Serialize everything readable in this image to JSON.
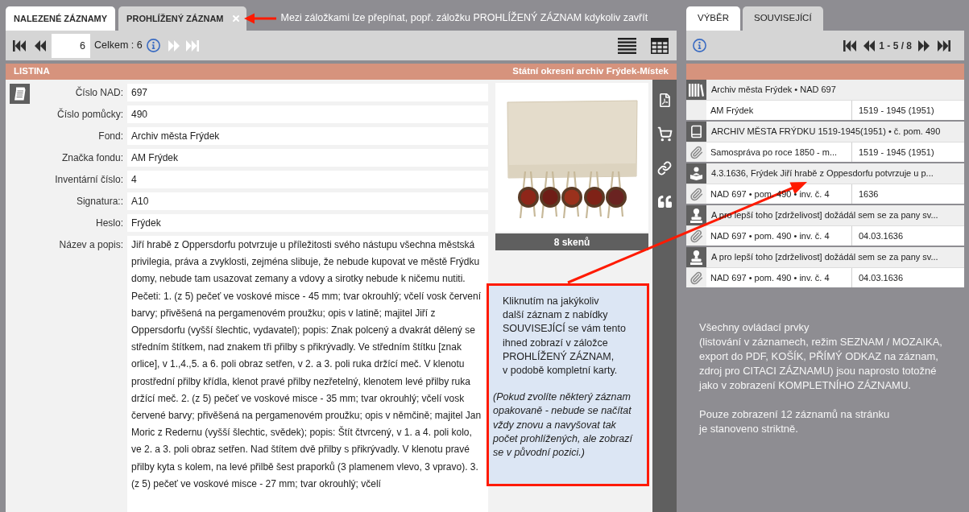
{
  "left_panel": {
    "tabs": [
      {
        "label": "NALEZENÉ ZÁZNAMY",
        "selected": true,
        "closable": false
      },
      {
        "label": "PROHLÍŽENÝ ZÁZNAM",
        "selected": false,
        "closable": true
      }
    ],
    "tab_note": "Mezi záložkami lze přepínat, popř. záložku PROHLÍŽENÝ ZÁZNAM kdykoliv zavřít",
    "toolbar": {
      "back_buttons": [
        {
          "kind": "first",
          "disabled": false
        },
        {
          "kind": "prev",
          "disabled": false
        }
      ],
      "page": "6",
      "total": "Celkem : 6",
      "forward_buttons": [
        {
          "kind": "next",
          "disabled": true
        },
        {
          "kind": "last",
          "disabled": true
        }
      ],
      "view_modes": [
        {
          "kind": "list"
        },
        {
          "kind": "grid"
        }
      ]
    },
    "header": {
      "record_type": "LISTINA",
      "archive": "Státní okresní archiv Frýdek-Místek"
    },
    "fields": [
      {
        "label": "Číslo NAD:",
        "value": "697"
      },
      {
        "label": "Číslo pomůcky:",
        "value": "490"
      },
      {
        "label": "Fond:",
        "value": "Archiv města Frýdek"
      },
      {
        "label": "Značka fondu:",
        "value": "AM Frýdek"
      },
      {
        "label": "Inventární číslo:",
        "value": "4"
      },
      {
        "label": "Signatura::",
        "value": "A10"
      },
      {
        "label": "Heslo:",
        "value": "Frýdek"
      }
    ],
    "description": {
      "label": "Název a popis:",
      "paragraphs": [
        "Jiří hrabě z Oppersdorfu potvrzuje u příležitosti svého nástupu všechna městská privilegia, práva a zvyklosti, zejména slibuje, že nebude kupovat ve městě Frýdku domy, nebude tam usazovat zemany a vdovy a sirotky nebude k ničemu nutiti.",
        "Pečeti: 1. (z 5) pečeť ve voskové misce - 45 mm; tvar okrouhlý; včelí vosk červení barvy; přivěšená na pergamenovém proužku; opis v latině; majitel Jiří z Oppersdorfu (vyšší šlechtic, vydavatel); popis: Znak polcený a dvakrát dělený se středním štítkem, nad znakem tři přilby s přikrývadly. Ve středním štítku [znak orlice], v 1.,4.,5. a 6. poli obraz setřen, v 2. a 3. poli ruka držící meč. V klenotu prostřední přilby křídla, klenot pravé přilby nezřetelný, klenotem levé přilby ruka držící meč. 2. (z 5) pečeť ve voskové misce - 35 mm; tvar okrouhlý; včelí vosk červené barvy; přivěšená na pergamenovém proužku; opis v němčině; majitel Jan Moric z Redernu (vyšší šlechtic, svědek); popis: Štít čtvrcený, v 1. a 4. poli kolo, ve 2. a 3. poli obraz setřen. Nad štítem dvě přilby s přikrývadly. V klenotu pravé přilby kyta s kolem, na levé přilbě šest praporků (3 plamenem vlevo, 3 vpravo). 3. (z 5) pečeť ve voskové misce - 27 mm; tvar okrouhlý; včelí"
      ]
    },
    "scans": {
      "caption": "8 skenů"
    },
    "actions": [
      {
        "kind": "pdf"
      },
      {
        "kind": "cart"
      },
      {
        "kind": "link"
      },
      {
        "kind": "quote"
      }
    ]
  },
  "right_panel": {
    "tabs": [
      {
        "label": "VÝBĚR",
        "selected": true
      },
      {
        "label": "SOUVISEJÍCÍ",
        "selected": false
      }
    ],
    "pager": {
      "buttons_before": [
        {
          "kind": "first"
        },
        {
          "kind": "prev"
        }
      ],
      "range": "1 - 5 / 8",
      "buttons_after": [
        {
          "kind": "next"
        },
        {
          "kind": "last"
        }
      ]
    },
    "items": [
      {
        "kind": "fond",
        "title": "Archiv města Frýdek • NAD 697",
        "attachment": false,
        "detail": "AM Frýdek",
        "dates": "1519 - 1945 (1951)"
      },
      {
        "kind": "finding_aid",
        "title": "ARCHIV MĚSTA FRÝDKU 1519-1945(1951) • č. pom. 490",
        "attachment": true,
        "detail": "Samospráva po roce 1850 - m...",
        "dates": "1519 - 1945 (1951)"
      },
      {
        "kind": "record",
        "title": "4.3.1636, Frýdek Jiří hrabě z Oppesdorfu potvrzuje u p...",
        "attachment": true,
        "detail": "NAD 697 • pom. 490 • inv. č. 4",
        "dates": "1636"
      },
      {
        "kind": "seal",
        "title": "A pro lepší toho [zdrželivost] dožádál sem se za pany sv...",
        "attachment": true,
        "detail": "NAD 697 • pom. 490 • inv. č. 4",
        "dates": "04.03.1636"
      },
      {
        "kind": "seal",
        "title": "A pro lepší toho [zdrželivost] dožádál sem se za pany sv...",
        "attachment": true,
        "detail": "NAD 697 • pom. 490 • inv. č. 4",
        "dates": "04.03.1636"
      }
    ],
    "notes": [
      "Všechny ovládací prvky\n(listování v záznamech, režim SEZNAM / MOZAIKA,\nexport do PDF, KOŠÍK, PŘÍMÝ ODKAZ na záznam,\nzdroj pro CITACI ZÁZNAMU) jsou naprosto totožné\njako v zobrazení KOMPLETNÍHO ZÁZNAMU.",
      "Pouze zobrazení 12 záznamů na stránku\nje stanoveno striktně."
    ]
  },
  "callout": {
    "text": "Kliknutím na jakýkoliv\ndalší záznam z nabídky\nSOUVISEJÍCÍ se vám tento\nihned zobrazí v záložce\nPROHLÍŽENÝ ZÁZNAM,\nv podobě kompletní karty.",
    "note": "(Pokud zvolíte některý záznam\nopakovaně - nebude se načítat\nvždy znovu a navyšovat tak\npočet prohlížených, ale zobrazí\nse v původní pozici.)"
  }
}
